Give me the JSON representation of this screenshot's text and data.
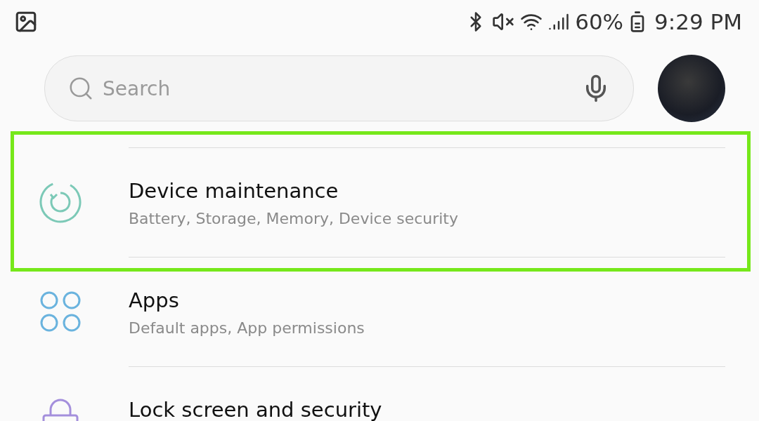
{
  "status_bar": {
    "battery_percent": "60%",
    "time": "9:29 PM"
  },
  "search": {
    "placeholder": "Search"
  },
  "settings": [
    {
      "kind": "maintenance",
      "title": "Device maintenance",
      "subtitle": "Battery, Storage, Memory, Device security",
      "highlighted": true
    },
    {
      "kind": "apps",
      "title": "Apps",
      "subtitle": "Default apps, App permissions",
      "highlighted": false
    },
    {
      "kind": "lock",
      "title": "Lock screen and security",
      "highlighted": false
    }
  ]
}
